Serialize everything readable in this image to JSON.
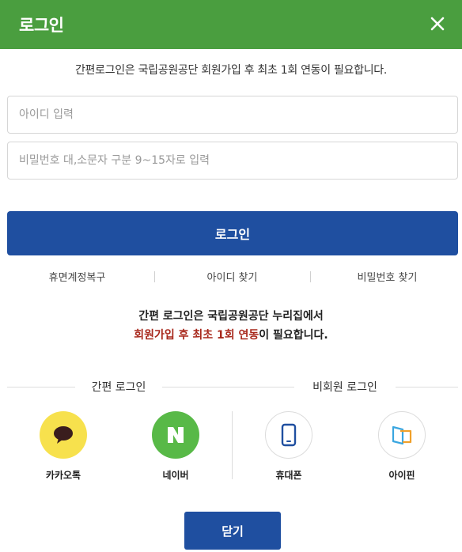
{
  "header": {
    "title": "로그인",
    "close_icon": "close-icon"
  },
  "notice": "간편로그인은 국립공원공단 회원가입 후 최초 1회 연동이 필요합니다.",
  "form": {
    "id_placeholder": "아이디 입력",
    "id_value": "",
    "pw_placeholder": "비밀번호 대,소문자 구분 9~15자로 입력",
    "pw_value": "",
    "login_label": "로그인"
  },
  "links": {
    "dormant": "휴면계정복구",
    "find_id": "아이디 찾기",
    "find_pw": "비밀번호 찾기"
  },
  "message": {
    "line1": "간편 로그인은 국립공원공단 누리집에서",
    "line2_highlight": "회원가입 후 최초 1회 연동",
    "line2_rest": "이 필요합니다."
  },
  "sections": {
    "easy_login": "간편 로그인",
    "non_member": "비회원 로그인"
  },
  "sns": {
    "kakao": {
      "label": "카카오톡",
      "icon": "speech-bubble-icon",
      "color": "#f7e14d"
    },
    "naver": {
      "label": "네이버",
      "icon": "naver-n-icon",
      "color": "#58b947"
    },
    "phone": {
      "label": "휴대폰",
      "icon": "mobile-phone-icon"
    },
    "ipin": {
      "label": "아이핀",
      "icon": "ipin-icon"
    }
  },
  "footer": {
    "close_label": "닫기"
  },
  "colors": {
    "header_green": "#4a9e3f",
    "primary_blue": "#1f4fa0",
    "highlight_red": "#a8281c"
  }
}
